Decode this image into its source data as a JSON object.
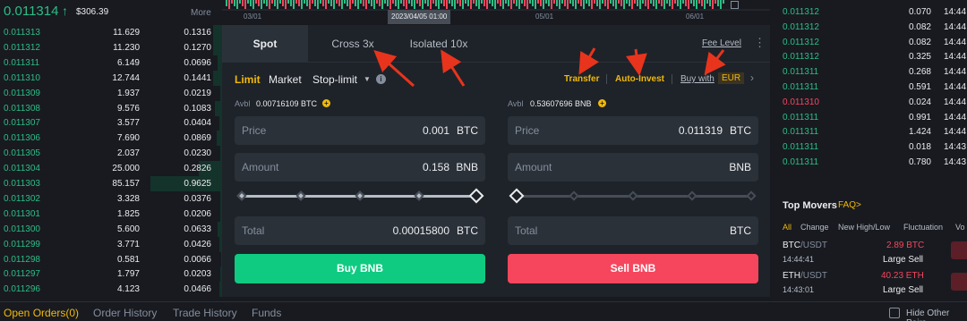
{
  "order_book": {
    "last_price": "0.011314",
    "last_price_arrow": "↑",
    "last_price_usd": "$306.39",
    "more_label": "More",
    "rows": [
      {
        "price": "0.011313",
        "amount": "11.629",
        "total": "0.1316",
        "depth": 0.12
      },
      {
        "price": "0.011312",
        "amount": "11.230",
        "total": "0.1270",
        "depth": 0.12
      },
      {
        "price": "0.011311",
        "amount": "6.149",
        "total": "0.0696",
        "depth": 0.06
      },
      {
        "price": "0.011310",
        "amount": "12.744",
        "total": "0.1441",
        "depth": 0.13
      },
      {
        "price": "0.011309",
        "amount": "1.937",
        "total": "0.0219",
        "depth": 0.02
      },
      {
        "price": "0.011308",
        "amount": "9.576",
        "total": "0.1083",
        "depth": 0.1
      },
      {
        "price": "0.011307",
        "amount": "3.577",
        "total": "0.0404",
        "depth": 0.04
      },
      {
        "price": "0.011306",
        "amount": "7.690",
        "total": "0.0869",
        "depth": 0.08
      },
      {
        "price": "0.011305",
        "amount": "2.037",
        "total": "0.0230",
        "depth": 0.02
      },
      {
        "price": "0.011304",
        "amount": "25.000",
        "total": "0.2826",
        "depth": 0.33
      },
      {
        "price": "0.011303",
        "amount": "85.157",
        "total": "0.9625",
        "depth": 1.0
      },
      {
        "price": "0.011302",
        "amount": "3.328",
        "total": "0.0376",
        "depth": 0.03
      },
      {
        "price": "0.011301",
        "amount": "1.825",
        "total": "0.0206",
        "depth": 0.02
      },
      {
        "price": "0.011300",
        "amount": "5.600",
        "total": "0.0633",
        "depth": 0.06
      },
      {
        "price": "0.011299",
        "amount": "3.771",
        "total": "0.0426",
        "depth": 0.04
      },
      {
        "price": "0.011298",
        "amount": "0.581",
        "total": "0.0066",
        "depth": 0.01
      },
      {
        "price": "0.011297",
        "amount": "1.797",
        "total": "0.0203",
        "depth": 0.02
      },
      {
        "price": "0.011296",
        "amount": "4.123",
        "total": "0.0466",
        "depth": 0.04
      }
    ]
  },
  "chart_strip": {
    "dates": [
      "03/01",
      "05/01",
      "06/01"
    ],
    "crosshair_label": "2023/04/05 01:00",
    "colors": {
      "up": "#2ebd85",
      "down": "#f6465d"
    }
  },
  "form": {
    "tabs": {
      "spot": "Spot",
      "cross": "Cross 3x",
      "isolated": "Isolated 10x",
      "fee_level": "Fee Level"
    },
    "order_types": {
      "limit": "Limit",
      "market": "Market",
      "stop_limit": "Stop-limit"
    },
    "links": {
      "transfer": "Transfer",
      "auto_invest": "Auto-Invest",
      "buy_with": "Buy with",
      "currency": "EUR"
    },
    "buy": {
      "avbl_label": "Avbl",
      "avbl_value": "0.00716109 BTC",
      "price_label": "Price",
      "price_value": "0.001",
      "price_unit": "BTC",
      "amount_label": "Amount",
      "amount_value": "0.158",
      "amount_unit": "BNB",
      "total_label": "Total",
      "total_value": "0.00015800",
      "total_unit": "BTC",
      "button": "Buy BNB",
      "slider_fraction": 1.0
    },
    "sell": {
      "avbl_label": "Avbl",
      "avbl_value": "0.53607696 BNB",
      "price_label": "Price",
      "price_value": "0.011319",
      "price_unit": "BTC",
      "amount_label": "Amount",
      "amount_value": "",
      "amount_unit": "BNB",
      "total_label": "Total",
      "total_value": "",
      "total_unit": "BTC",
      "button": "Sell BNB",
      "slider_fraction": 0.0
    },
    "colors": {
      "accent": "#f0b90b",
      "buy": "#0ecb81",
      "sell": "#f6465d"
    }
  },
  "trades": {
    "rows": [
      {
        "price": "0.011312",
        "amount": "0.070",
        "time": "14:44",
        "side": "buy"
      },
      {
        "price": "0.011312",
        "amount": "0.082",
        "time": "14:44",
        "side": "buy"
      },
      {
        "price": "0.011312",
        "amount": "0.082",
        "time": "14:44",
        "side": "buy"
      },
      {
        "price": "0.011312",
        "amount": "0.325",
        "time": "14:44",
        "side": "buy"
      },
      {
        "price": "0.011311",
        "amount": "0.268",
        "time": "14:44",
        "side": "buy"
      },
      {
        "price": "0.011311",
        "amount": "0.591",
        "time": "14:44",
        "side": "buy"
      },
      {
        "price": "0.011310",
        "amount": "0.024",
        "time": "14:44",
        "side": "sell"
      },
      {
        "price": "0.011311",
        "amount": "0.991",
        "time": "14:44",
        "side": "buy"
      },
      {
        "price": "0.011311",
        "amount": "1.424",
        "time": "14:44",
        "side": "buy"
      },
      {
        "price": "0.011311",
        "amount": "0.018",
        "time": "14:43",
        "side": "buy"
      },
      {
        "price": "0.011311",
        "amount": "0.780",
        "time": "14:43",
        "side": "buy"
      }
    ]
  },
  "top_movers": {
    "title": "Top Movers",
    "faq": "FAQ>",
    "filters": [
      "All",
      "Change",
      "New High/Low",
      "Fluctuation",
      "Vo"
    ],
    "items": [
      {
        "base": "BTC",
        "quote": "/USDT",
        "time": "14:44:41",
        "value": "2.89 BTC",
        "label": "Large Sell"
      },
      {
        "base": "ETH",
        "quote": "/USDT",
        "time": "14:43:01",
        "value": "40.23 ETH",
        "label": "Large Sell"
      }
    ]
  },
  "bottom": {
    "open_orders": "Open Orders",
    "open_orders_count": "(0)",
    "order_history": "Order History",
    "trade_history": "Trade History",
    "funds": "Funds",
    "hide_pairs": "Hide Other Pairs"
  }
}
